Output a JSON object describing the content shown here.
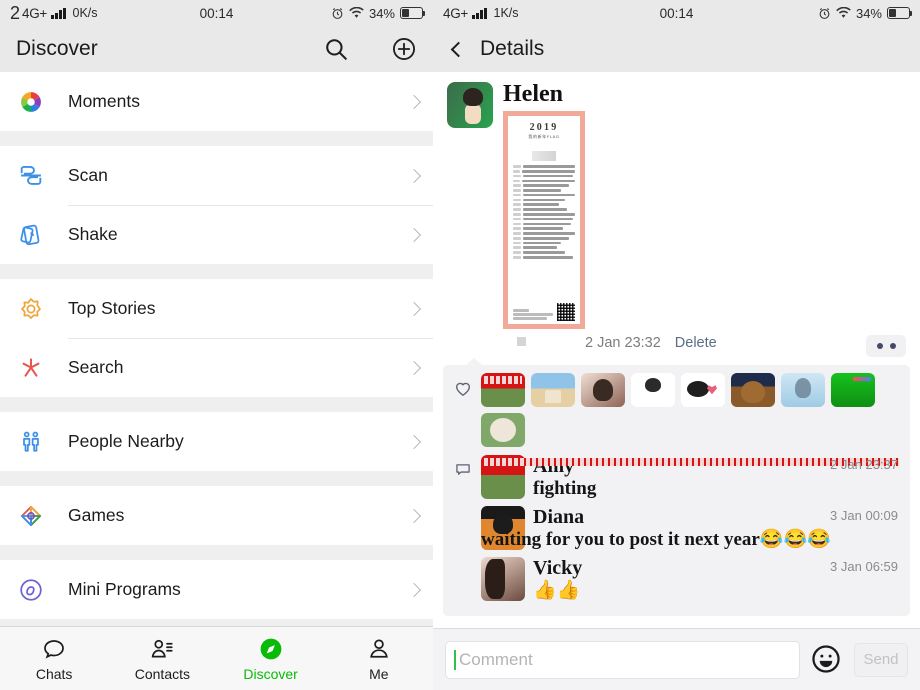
{
  "left": {
    "status": {
      "prefix": "2",
      "carrier": "4G+",
      "speed": "0K/s",
      "time": "00:14",
      "battery_pct": "34%"
    },
    "nav": {
      "title": "Discover",
      "search_icon": "search-icon",
      "add_icon": "plus-circle-icon"
    },
    "menu_groups": [
      {
        "items": [
          {
            "label": "Moments",
            "icon": "moments-aperture-icon"
          }
        ]
      },
      {
        "items": [
          {
            "label": "Scan",
            "icon": "scan-icon"
          },
          {
            "label": "Shake",
            "icon": "shake-icon"
          }
        ]
      },
      {
        "items": [
          {
            "label": "Top Stories",
            "icon": "top-stories-icon"
          },
          {
            "label": "Search",
            "icon": "search-star-icon"
          }
        ]
      },
      {
        "items": [
          {
            "label": "People Nearby",
            "icon": "people-nearby-icon"
          }
        ]
      },
      {
        "items": [
          {
            "label": "Games",
            "icon": "games-icon"
          }
        ]
      },
      {
        "items": [
          {
            "label": "Mini Programs",
            "icon": "mini-programs-icon"
          }
        ]
      }
    ],
    "tabs": [
      {
        "label": "Chats",
        "icon": "chat-bubble-icon",
        "active": false
      },
      {
        "label": "Contacts",
        "icon": "contacts-icon",
        "active": false
      },
      {
        "label": "Discover",
        "icon": "discover-compass-icon",
        "active": true
      },
      {
        "label": "Me",
        "icon": "person-icon",
        "active": false
      }
    ],
    "active_tab_color": "#09bb07"
  },
  "right": {
    "status": {
      "carrier": "4G+",
      "speed": "1K/s",
      "time": "00:14",
      "battery_pct": "34%"
    },
    "nav": {
      "back_icon": "back-chevron-icon",
      "title": "Details"
    },
    "post": {
      "author": "Helen",
      "avatar": "helen-avatar",
      "image": {
        "name": "new-year-flag-poster",
        "year": "2019",
        "subtitle": "我的新年FLAG",
        "line_count": 22,
        "border_color": "#f2a99a",
        "has_qr_code": true
      },
      "time": "2 Jan 23:32",
      "delete_label": "Delete",
      "more_button": "more-dots-button"
    },
    "interactions": {
      "like_icon": "heart-outline-icon",
      "comment_icon": "comment-bubble-icon",
      "likers": [
        {
          "name": "liker-1",
          "thumb": "img-amy"
        },
        {
          "name": "liker-2",
          "thumb": "img-beach"
        },
        {
          "name": "liker-3",
          "thumb": "img-girl"
        },
        {
          "name": "liker-4",
          "thumb": "img-doodle"
        },
        {
          "name": "liker-5",
          "thumb": "img-panda"
        },
        {
          "name": "liker-6",
          "thumb": "img-bear"
        },
        {
          "name": "liker-7",
          "thumb": "img-blue"
        },
        {
          "name": "liker-8",
          "thumb": "img-green"
        },
        {
          "name": "liker-9",
          "thumb": "img-mouse"
        }
      ],
      "comments": [
        {
          "name": "Amy",
          "text": "fighting",
          "time": "2 Jan 23:37",
          "thumb": "img-amy",
          "indent": false
        },
        {
          "name": "Diana",
          "text": "waiting for you to post it next year😂😂😂",
          "time": "3 Jan 00:09",
          "thumb": "img-diana",
          "indent": true
        },
        {
          "name": "Vicky",
          "text": "👍👍",
          "time": "3 Jan 06:59",
          "thumb": "img-vicky",
          "indent": false
        }
      ]
    },
    "composer": {
      "placeholder": "Comment",
      "value": "",
      "emoji_icon": "emoji-smiley-icon",
      "send_label": "Send",
      "caret_color": "#2ec14e"
    }
  }
}
